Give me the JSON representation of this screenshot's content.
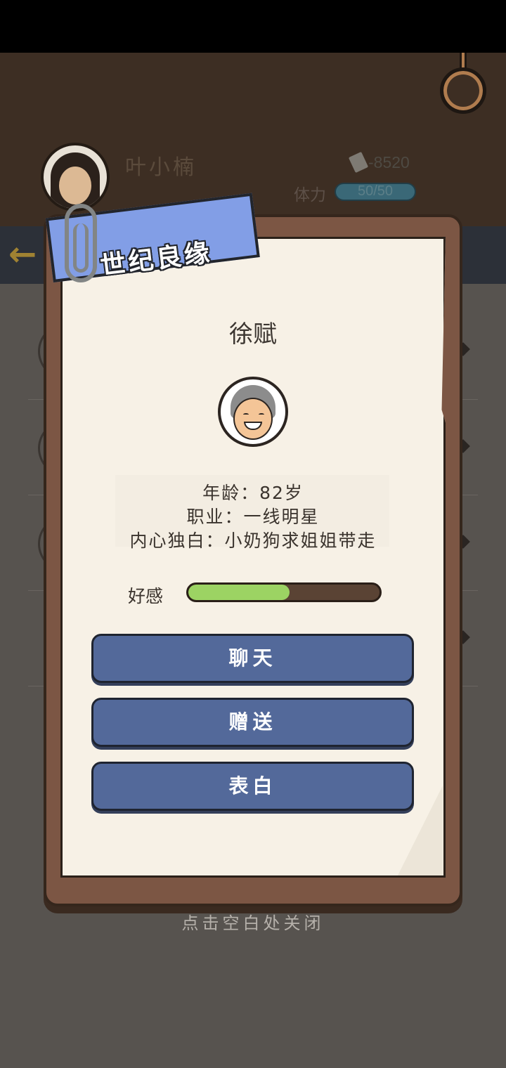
{
  "player": {
    "name": "叶小楠",
    "money": "-8520",
    "stamina_label": "体力",
    "stamina_value": "50/50"
  },
  "modal": {
    "ribbon_title": "世纪良缘",
    "character_name": "徐赋",
    "info": {
      "age": "年龄：82岁",
      "job": "职业：一线明星",
      "monologue": "内心独白：小奶狗求姐姐带走"
    },
    "favor_label": "好感",
    "favor_fraction": 0.53,
    "buttons": {
      "chat": "聊天",
      "gift": "赠送",
      "confess": "表白"
    },
    "close_hint": "点击空白处关闭"
  },
  "colors": {
    "button": "#53699a",
    "favor_fill": "#9cd363",
    "ribbon": "#829ee6",
    "board": "#7c5644"
  },
  "icons": [
    "back-arrow-icon",
    "money-icon",
    "paperclip-icon"
  ]
}
